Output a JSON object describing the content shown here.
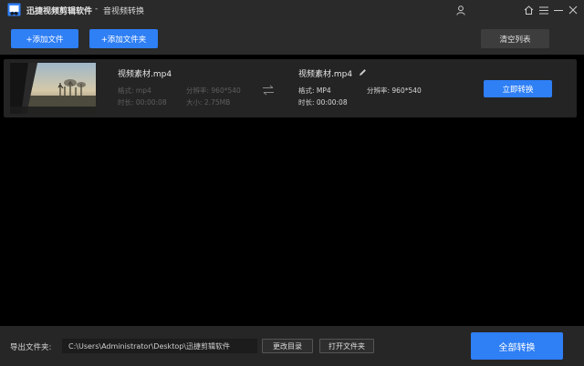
{
  "titlebar": {
    "app_name": "迅捷视频剪辑软件",
    "separator": "-",
    "module": "音视频转换",
    "icons": [
      "user-icon",
      "home-icon",
      "menu-icon",
      "minimize-icon",
      "close-icon"
    ]
  },
  "toolbar": {
    "add_file_label": "+添加文件",
    "add_folder_label": "+添加文件夹",
    "clear_list_label": "清空列表"
  },
  "file_item": {
    "source": {
      "name": "视频素材.mp4",
      "format_label": "格式: mp4",
      "resolution_label": "分辨率: 960*540",
      "duration_label": "时长: 00:00:08",
      "size_label": "大小: 2.75MB"
    },
    "target": {
      "name": "视频素材.mp4",
      "format_label": "格式: MP4",
      "resolution_label": "分辨率: 960*540",
      "duration_label": "时长: 00:00:08"
    },
    "convert_label": "立即转换"
  },
  "bottom": {
    "output_label": "导出文件夹:",
    "output_path": "C:\\Users\\Administrator\\Desktop\\迅捷剪辑软件",
    "change_dir_label": "更改目录",
    "open_folder_label": "打开文件夹",
    "convert_all_label": "全部转换"
  },
  "colors": {
    "accent": "#2f7ff5",
    "background": "#000000",
    "panel": "#242424"
  }
}
